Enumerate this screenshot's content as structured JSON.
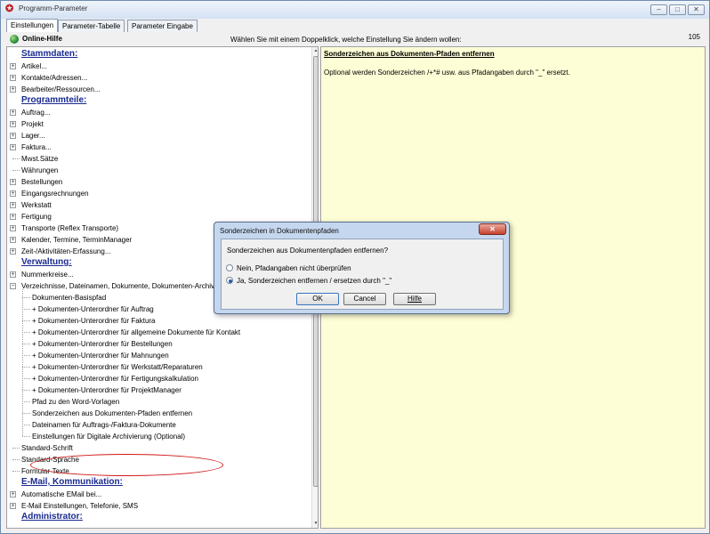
{
  "window": {
    "title": "Programm-Parameter",
    "controls": [
      "–",
      "□",
      "✕"
    ]
  },
  "tabs": [
    "Einstellungen",
    "Parameter-Tabelle",
    "Parameter Eingabe"
  ],
  "header": {
    "help_title": "Online-Hilfe",
    "instruction": "Wählen Sie mit einem Doppelklick, welche Einstellung Sie ändern wollen:",
    "counter": "105"
  },
  "tree": [
    {
      "label": "Stammdaten:",
      "kind": "section"
    },
    {
      "label": "Artikel...",
      "kind": "item",
      "expander": true,
      "indent": 0
    },
    {
      "label": "Kontakte/Adressen...",
      "kind": "item",
      "expander": true,
      "indent": 0
    },
    {
      "label": "Bearbeiter/Ressourcen...",
      "kind": "item",
      "expander": true,
      "indent": 0
    },
    {
      "label": "Programmteile:",
      "kind": "section"
    },
    {
      "label": "Auftrag...",
      "kind": "item",
      "expander": true,
      "indent": 0
    },
    {
      "label": "Projekt",
      "kind": "item",
      "expander": true,
      "indent": 0
    },
    {
      "label": "Lager...",
      "kind": "item",
      "expander": true,
      "indent": 0
    },
    {
      "label": "Faktura...",
      "kind": "item",
      "expander": true,
      "indent": 0
    },
    {
      "label": "Mwst.Sätze",
      "kind": "item",
      "expander": false,
      "indent": 0
    },
    {
      "label": "Währungen",
      "kind": "item",
      "expander": false,
      "indent": 0
    },
    {
      "label": "Bestellungen",
      "kind": "item",
      "expander": true,
      "indent": 0
    },
    {
      "label": "Eingangsrechnungen",
      "kind": "item",
      "expander": true,
      "indent": 0
    },
    {
      "label": "Werkstatt",
      "kind": "item",
      "expander": true,
      "indent": 0
    },
    {
      "label": "Fertigung",
      "kind": "item",
      "expander": true,
      "indent": 0
    },
    {
      "label": "Transporte (Reflex Transporte)",
      "kind": "item",
      "expander": true,
      "indent": 0
    },
    {
      "label": "Kalender, Termine, TerminManager",
      "kind": "item",
      "expander": true,
      "indent": 0
    },
    {
      "label": "Zeit-/Aktivitäten-Erfassung...",
      "kind": "item",
      "expander": true,
      "indent": 0
    },
    {
      "label": "Verwaltung:",
      "kind": "section"
    },
    {
      "label": "Nummerkreise...",
      "kind": "item",
      "expander": true,
      "indent": 0
    },
    {
      "label": "Verzeichnisse, Dateinamen, Dokumente, Dokumenten-Archiv",
      "kind": "item",
      "expander": "open",
      "indent": 0
    },
    {
      "label": "Dokumenten-Basispfad",
      "kind": "item",
      "expander": false,
      "indent": 1
    },
    {
      "label": "+ Dokumenten-Unterordner für Auftrag",
      "kind": "item",
      "expander": false,
      "indent": 1
    },
    {
      "label": "+ Dokumenten-Unterordner für Faktura",
      "kind": "item",
      "expander": false,
      "indent": 1
    },
    {
      "label": "+ Dokumenten-Unterordner für allgemeine Dokumente für Kontakt",
      "kind": "item",
      "expander": false,
      "indent": 1
    },
    {
      "label": "+ Dokumenten-Unterordner für Bestellungen",
      "kind": "item",
      "expander": false,
      "indent": 1
    },
    {
      "label": "+ Dokumenten-Unterordner für Mahnungen",
      "kind": "item",
      "expander": false,
      "indent": 1
    },
    {
      "label": "+ Dokumenten-Unterordner für Werkstatt/Reparaturen",
      "kind": "item",
      "expander": false,
      "indent": 1
    },
    {
      "label": "+ Dokumenten-Unterordner für Fertigungskalkulation",
      "kind": "item",
      "expander": false,
      "indent": 1
    },
    {
      "label": "+ Dokumenten-Unterordner für ProjektManager",
      "kind": "item",
      "expander": false,
      "indent": 1
    },
    {
      "label": "Pfad zu den Word-Vorlagen",
      "kind": "item",
      "expander": false,
      "indent": 1
    },
    {
      "label": "Sonderzeichen aus Dokumenten-Pfaden entfernen",
      "kind": "item",
      "expander": false,
      "indent": 1,
      "selected": true
    },
    {
      "label": "Dateinamen für Auftrags-/Faktura-Dokumente",
      "kind": "item",
      "expander": false,
      "indent": 1
    },
    {
      "label": "Einstellungen für Digitale Archivierung (Optional)",
      "kind": "item",
      "expander": false,
      "indent": 1
    },
    {
      "label": "Standard-Schrift",
      "kind": "item",
      "expander": false,
      "indent": 0
    },
    {
      "label": "Standard-Sprache",
      "kind": "item",
      "expander": false,
      "indent": 0
    },
    {
      "label": "Formular-Texte",
      "kind": "item",
      "expander": false,
      "indent": 0
    },
    {
      "label": "E-Mail, Kommunikation:",
      "kind": "section"
    },
    {
      "label": "Automatische EMail bei...",
      "kind": "item",
      "expander": true,
      "indent": 0
    },
    {
      "label": "E-Mail Einstellungen, Telefonie, SMS",
      "kind": "item",
      "expander": true,
      "indent": 0
    },
    {
      "label": "Administrator:",
      "kind": "section"
    }
  ],
  "help_panel": {
    "title": "Sonderzeichen aus Dokumenten-Pfaden entfernen",
    "description": "Optional werden Sonderzeichen /+*# usw. aus Pfadangaben durch \"_\" ersetzt."
  },
  "dialog": {
    "title": "Sonderzeichen in Dokumentenpfaden",
    "close_label": "✕",
    "question": "Sonderzeichen aus Dokumentenpfaden entfernen?",
    "options": [
      {
        "label": "Nein, Pfadangaben nicht überprüfen",
        "checked": false
      },
      {
        "label": "Ja, Sonderzeichen entfernen / ersetzen durch \"_\"",
        "checked": true
      }
    ],
    "ok_label": "OK",
    "cancel_label": "Cancel",
    "help_label": "Hilfe"
  },
  "colors": {
    "section_text": "#1a2a90",
    "help_panel_bg": "#fefed6",
    "highlight": "#d01818"
  }
}
